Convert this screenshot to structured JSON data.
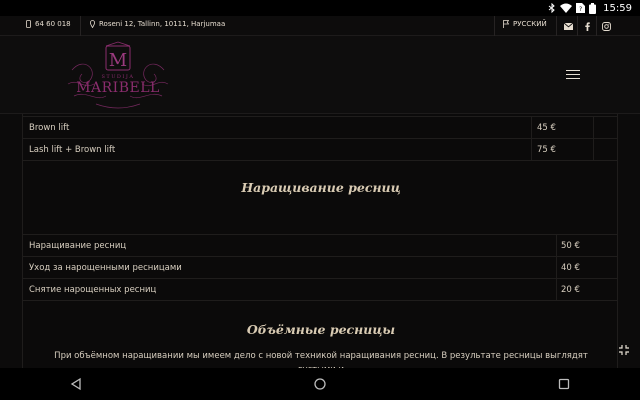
{
  "status_bar": {
    "time": "15:59"
  },
  "topbar": {
    "phone": "64 60 018",
    "address": "Roseni 12, Tallinn, 10111, Harjumaa",
    "language": "РУССКИЙ"
  },
  "logo": {
    "letter": "M",
    "small_text": "STUDIJA",
    "name": "MARIBELL"
  },
  "lift_rows": [
    {
      "name": "Brown lift",
      "price": "45 €"
    },
    {
      "name": "Lash lift + Brown lift",
      "price": "75 €"
    }
  ],
  "section_extensions": {
    "title": "Наращивание ресниц",
    "rows": [
      {
        "name": "Наращивание ресниц",
        "price": "50 €"
      },
      {
        "name": "Уход за нарощенными ресницами",
        "price": "40 €"
      },
      {
        "name": "Снятие нарощенных ресниц",
        "price": "20 €"
      }
    ]
  },
  "section_volume": {
    "title": "Объёмные ресницы",
    "paragraph": "При объёмном наращивании мы имеем дело с новой техникой наращивания ресниц. В результате ресницы выглядят густыми и"
  },
  "colors": {
    "accent": "#d9cbb3",
    "logo_purple": "#8a2d6d",
    "background": "#0b0a0a"
  }
}
